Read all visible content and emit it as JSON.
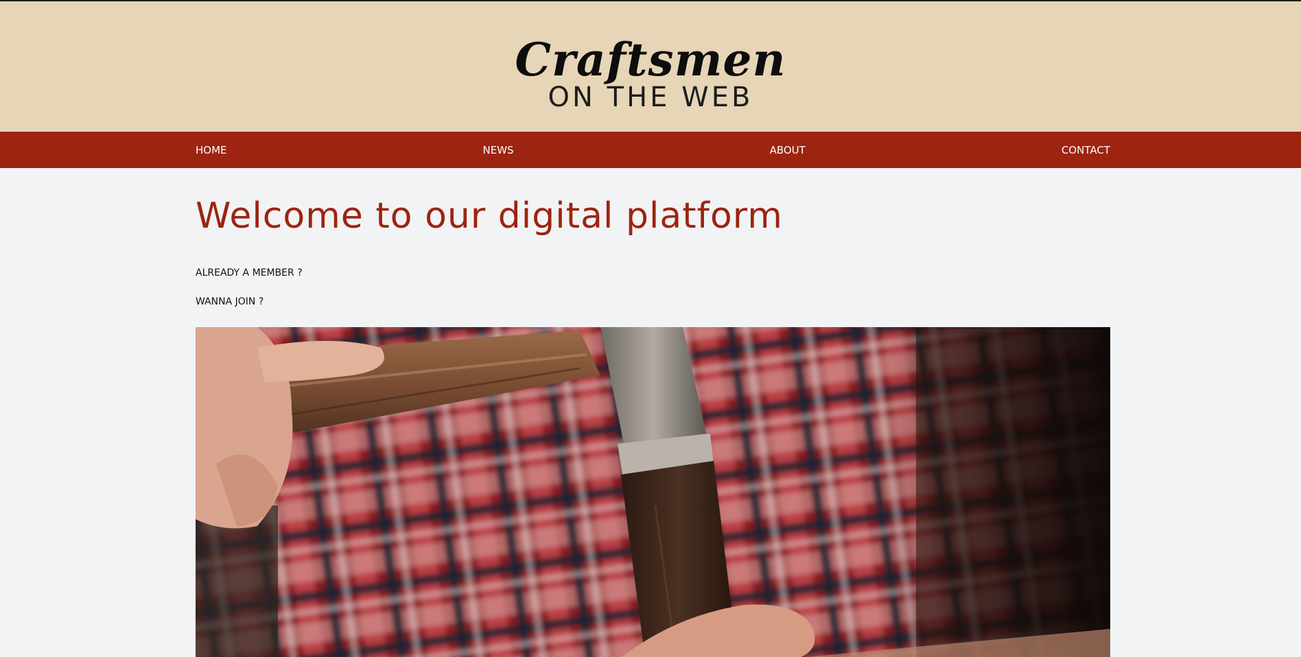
{
  "header": {
    "logo_main": "Craftsmen",
    "logo_sub": "ON THE WEB"
  },
  "nav": {
    "items": [
      {
        "label": "HOME"
      },
      {
        "label": "NEWS"
      },
      {
        "label": "ABOUT"
      },
      {
        "label": "CONTACT"
      }
    ]
  },
  "main": {
    "title": "Welcome to our digital platform",
    "member_link": "ALREADY A MEMBER ?",
    "join_link": "WANNA JOIN ?"
  },
  "colors": {
    "banner_bg": "#e6d5b6",
    "nav_bg": "#9d2410",
    "accent": "#9d2410",
    "page_bg": "#f2f3f5"
  }
}
